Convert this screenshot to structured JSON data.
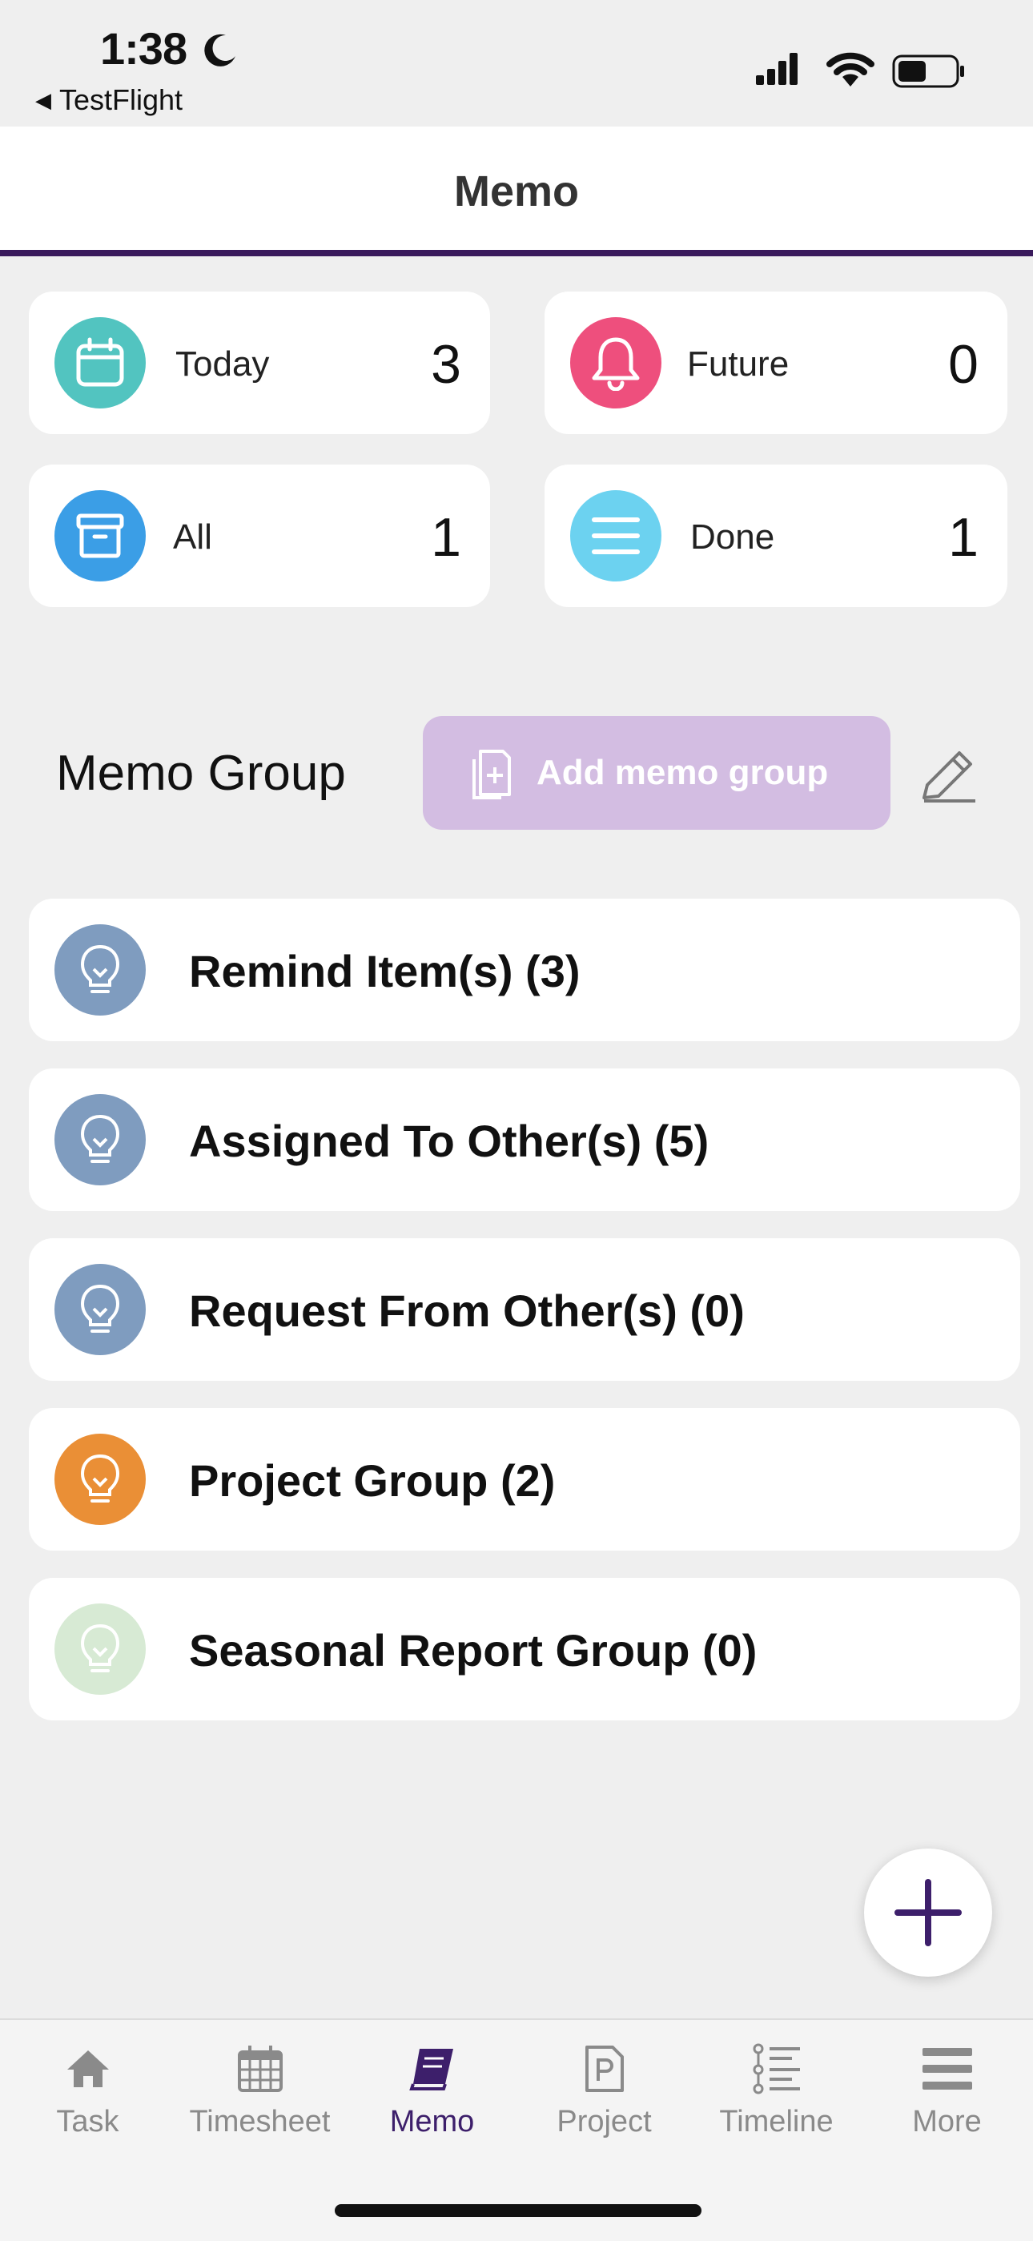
{
  "status_bar": {
    "time": "1:38",
    "back_app": "TestFlight"
  },
  "header": {
    "title": "Memo"
  },
  "summary": [
    {
      "label": "Today",
      "count": "3",
      "icon": "calendar-icon",
      "color": "#52c4c0"
    },
    {
      "label": "Future",
      "count": "0",
      "icon": "bell-icon",
      "color": "#ee4f7d"
    },
    {
      "label": "All",
      "count": "1",
      "icon": "archive-box-icon",
      "color": "#3b9ee6"
    },
    {
      "label": "Done",
      "count": "1",
      "icon": "list-lines-icon",
      "color": "#6cd2f0"
    }
  ],
  "memo_group": {
    "title": "Memo Group",
    "add_label": "Add memo group",
    "add_color": "#d3bde2"
  },
  "groups": [
    {
      "name": "Remind Item(s)  (3)",
      "icon": "lightbulb-icon",
      "color": "#7f9cbf"
    },
    {
      "name": "Assigned To Other(s)  (5)",
      "icon": "lightbulb-icon",
      "color": "#7f9cbf"
    },
    {
      "name": "Request From Other(s)  (0)",
      "icon": "lightbulb-icon",
      "color": "#7f9cbf"
    },
    {
      "name": "Project Group  (2)",
      "icon": "lightbulb-icon",
      "color": "#ea8f36"
    },
    {
      "name": "Seasonal Report Group  (0)",
      "icon": "lightbulb-icon",
      "color": "#d7ead4"
    }
  ],
  "tabs": [
    {
      "label": "Task",
      "icon": "home-icon"
    },
    {
      "label": "Timesheet",
      "icon": "calendar-grid-icon"
    },
    {
      "label": "Memo",
      "icon": "book-icon",
      "active": true
    },
    {
      "label": "Project",
      "icon": "project-doc-icon"
    },
    {
      "label": "Timeline",
      "icon": "timeline-icon"
    },
    {
      "label": "More",
      "icon": "menu-icon"
    }
  ],
  "accent_color": "#3d1f6b"
}
